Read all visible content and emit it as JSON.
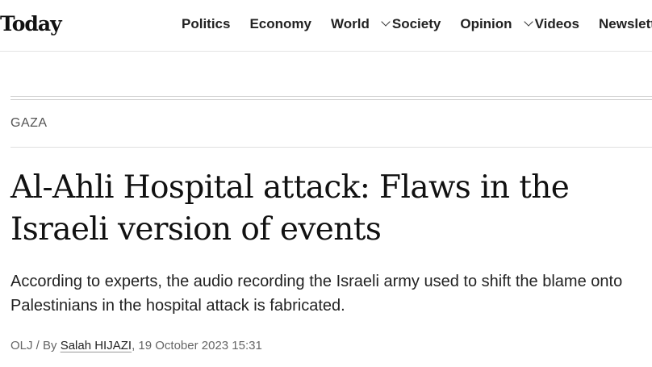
{
  "site": {
    "logo_text": "Today"
  },
  "nav": {
    "items": [
      {
        "label": "Politics"
      },
      {
        "label": "Economy"
      },
      {
        "label": "World"
      },
      {
        "label": "Society"
      },
      {
        "label": "Opinion"
      },
      {
        "label": "Videos"
      },
      {
        "label": "Newsletters"
      }
    ]
  },
  "article": {
    "section": "GAZA",
    "headline_line1": "Al-Ahli Hospital attack: Flaws in the",
    "headline_line2": "Israeli version of events",
    "deck_line1": "According to experts, the audio recording the Israeli army used to shift the blame onto",
    "deck_line2": "Palestinians in the hospital attack is fabricated.",
    "byline_prefix": "OLJ / By ",
    "author": "Salah HIJAZI",
    "date": ", 19 October 2023 15:31"
  }
}
